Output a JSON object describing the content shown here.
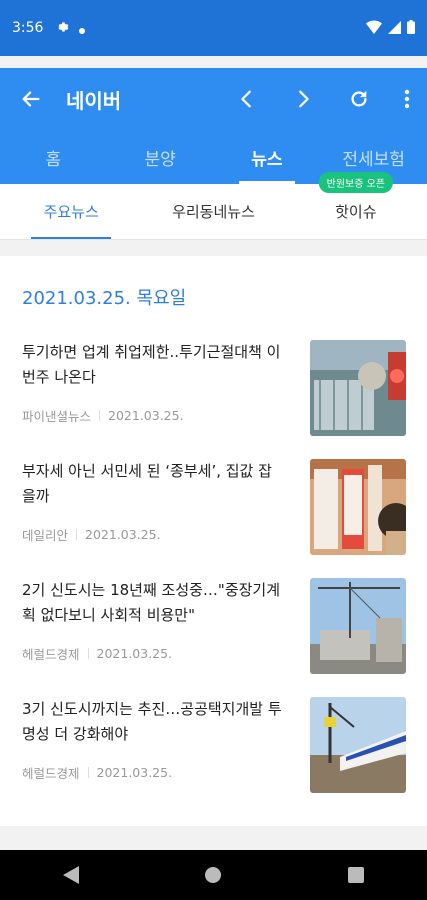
{
  "status_bar": {
    "time": "3:56"
  },
  "app_bar": {
    "title": "네이버"
  },
  "tabs": [
    {
      "label": "홈"
    },
    {
      "label": "분양"
    },
    {
      "label": "뉴스",
      "active": true
    },
    {
      "label": "전세보험"
    }
  ],
  "subtabs": [
    {
      "label": "주요뉴스",
      "active": true
    },
    {
      "label": "우리동네뉴스"
    },
    {
      "label": "핫이슈"
    }
  ],
  "badge": "반원보증 오픈",
  "date_heading": "2021.03.25. 목요일",
  "news": [
    {
      "title": "투기하면 업계 취업제한..투기근절대책 이번주 나온다",
      "source": "파이낸셜뉴스",
      "date": "2021.03.25."
    },
    {
      "title": "부자세 아닌 서민세 된 ‘종부세’, 집값 잡을까",
      "source": "데일리안",
      "date": "2021.03.25."
    },
    {
      "title": "2기 신도시는 18년째 조성중…\"중장기계획 없다보니 사회적 비용만\"",
      "source": "헤럴드경제",
      "date": "2021.03.25."
    },
    {
      "title": "3기 신도시까지는 추진…공공택지개발 투명성 더 강화해야",
      "source": "헤럴드경제",
      "date": "2021.03.25."
    }
  ]
}
